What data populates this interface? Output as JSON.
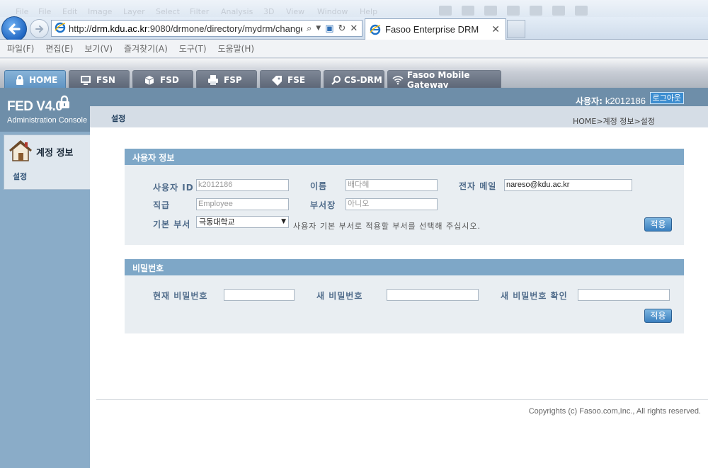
{
  "browser": {
    "ghost_menu": [
      "File",
      "Edit",
      "Image",
      "Layer",
      "Select",
      "Filter",
      "Analysis",
      "3D",
      "View",
      "Window",
      "Help"
    ],
    "address": {
      "host": "drm.kdu.ac.kr",
      "prefix": "http://",
      "path": ":9080/drmone/directory/mydrm/changeI"
    },
    "tab_title": "Fasoo Enterprise DRM",
    "menu": [
      "파일(F)",
      "편집(E)",
      "보기(V)",
      "즐겨찾기(A)",
      "도구(T)",
      "도움말(H)"
    ]
  },
  "app_tabs": [
    {
      "label": "HOME",
      "icon": "lock-icon"
    },
    {
      "label": "FSN",
      "icon": "monitor-icon"
    },
    {
      "label": "FSD",
      "icon": "package-icon"
    },
    {
      "label": "FSP",
      "icon": "printer-icon"
    },
    {
      "label": "FSE",
      "icon": "tag-icon"
    },
    {
      "label": "CS-DRM",
      "icon": "search-icon"
    },
    {
      "label": "Fasoo Mobile Gateway",
      "icon": "wifi-icon"
    }
  ],
  "brand": {
    "version": "FED V4.0",
    "subtitle": "Administration Console"
  },
  "sidebar": {
    "section": "계정 정보",
    "item": "설정"
  },
  "user": {
    "label": "사용자:",
    "id": "k2012186",
    "logout": "로그아웃"
  },
  "page": {
    "title": "설정",
    "breadcrumb": "HOME>계정 정보>설정"
  },
  "user_info": {
    "header": "사용자 정보",
    "labels": {
      "user_id": "사용자 ID",
      "name": "이름",
      "email": "전자 메일",
      "rank": "직급",
      "dept_head": "부서장",
      "default_dept": "기본 부서"
    },
    "values": {
      "user_id": "k2012186",
      "name": "배다혜",
      "email": "nareso@kdu.ac.kr",
      "rank": "Employee",
      "dept_head": "아니오",
      "default_dept": "극동대학교"
    },
    "hint": "사용자 기본 부서로 적용할 부서를 선택해 주십시오.",
    "apply": "적용"
  },
  "password": {
    "header": "비밀번호",
    "labels": {
      "current": "현재 비밀번호",
      "new": "새 비밀번호",
      "confirm": "새 비밀번호 확인"
    },
    "apply": "적용"
  },
  "footer": {
    "copyright": "Copyrights (c) Fasoo.com,Inc., All rights reserved."
  }
}
